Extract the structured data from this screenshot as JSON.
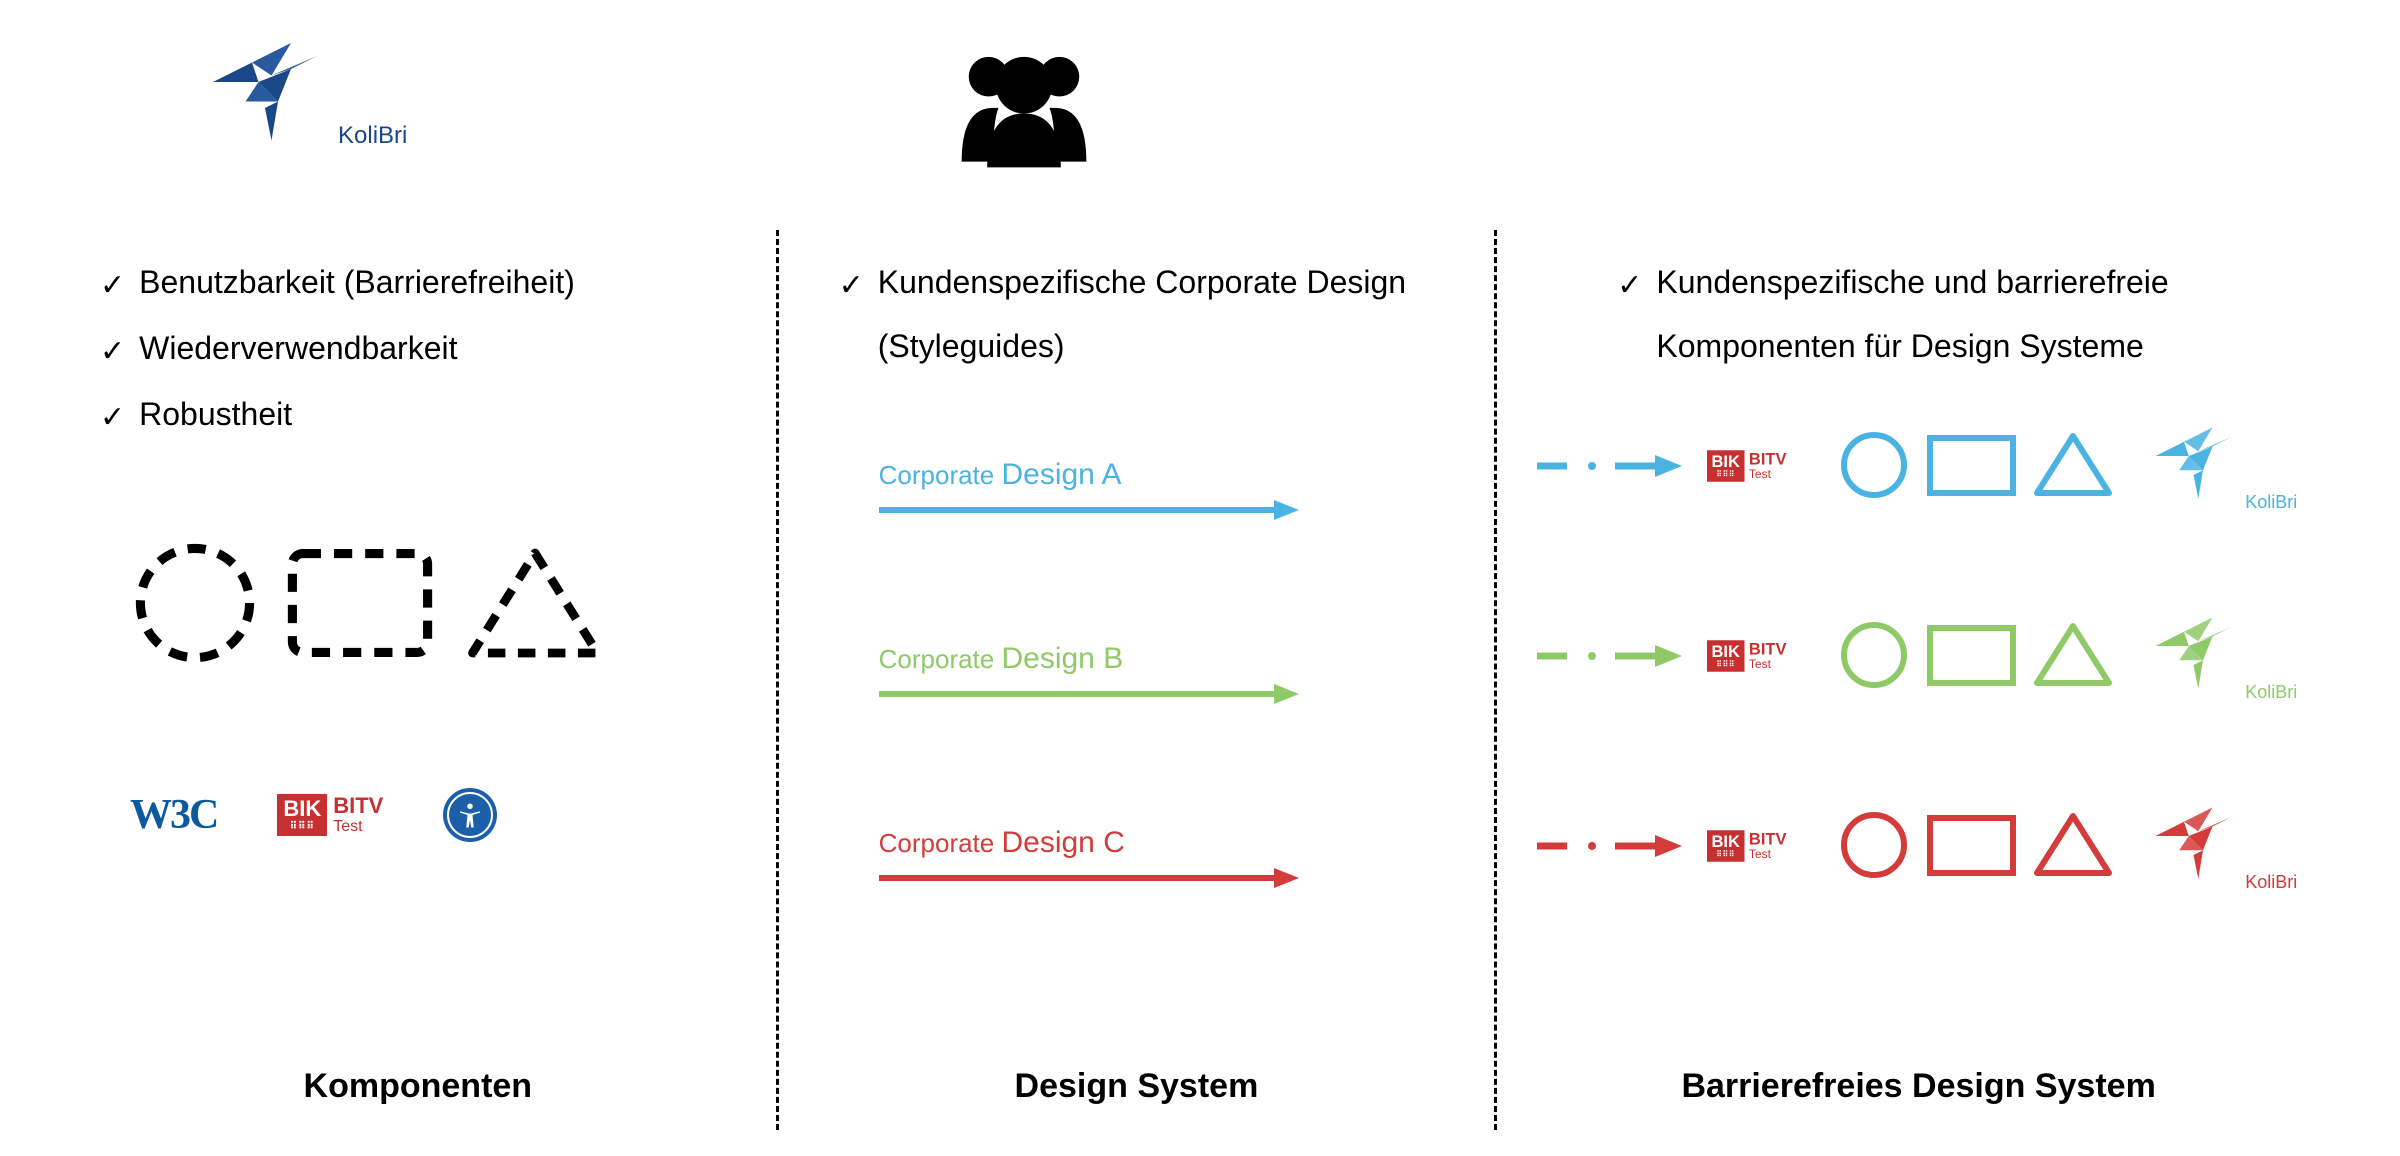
{
  "brand": {
    "name": "KoliBri",
    "color_primary": "#1b4788"
  },
  "columns": {
    "komponenten": {
      "title": "Komponenten",
      "bullets": [
        "Benutzbarkeit (Barrierefreiheit)",
        "Wiederverwendbarkeit",
        "Robustheit"
      ],
      "logos": {
        "w3c": "W3C",
        "bik": "BIK",
        "bitv": "BITV",
        "bitv_sub": "Test"
      }
    },
    "design_system": {
      "title": "Design System",
      "bullets": [
        "Kundenspezifische Corporate Design (Styleguides)"
      ],
      "designs": [
        {
          "label_prefix": "Corporate ",
          "label": "Design A",
          "color": "#4ab3e2"
        },
        {
          "label_prefix": "Corporate ",
          "label": "Design B",
          "color": "#8fc968"
        },
        {
          "label_prefix": "Corporate ",
          "label": "Design C",
          "color": "#d43b3b"
        }
      ]
    },
    "barrierefrei": {
      "title": "Barrierefreies Design System",
      "bullets": [
        "Kundenspezifische und barrierefreie Komponenten für Design Systeme"
      ],
      "rows": [
        {
          "color": "#4ab3e2"
        },
        {
          "color": "#8fc968"
        },
        {
          "color": "#d43b3b"
        }
      ],
      "bik": "BIK",
      "bitv": "BITV",
      "bitv_sub": "Test"
    }
  }
}
